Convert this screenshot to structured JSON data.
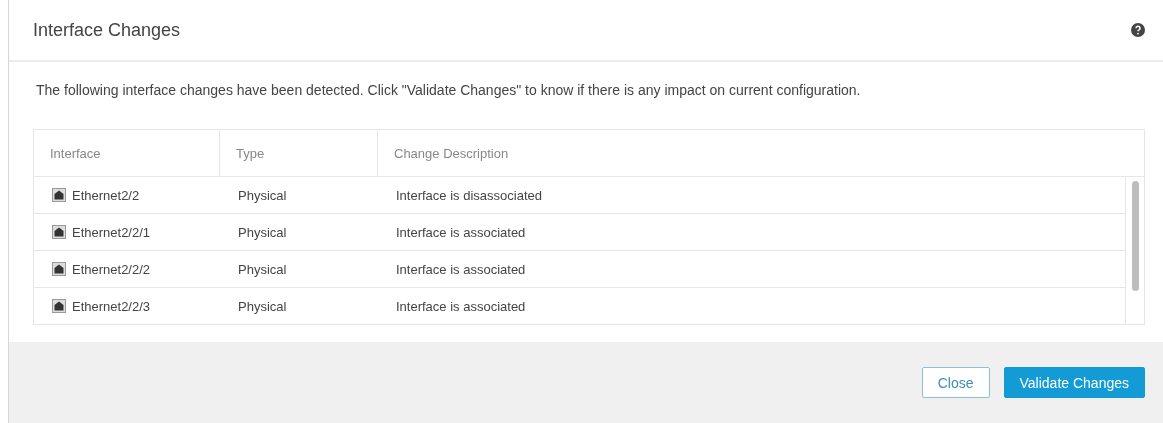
{
  "dialog": {
    "title": "Interface Changes",
    "description": "The following interface changes have been detected. Click \"Validate Changes\" to know if there is any impact on current configuration.",
    "table": {
      "columns": [
        "Interface",
        "Type",
        "Change Description"
      ],
      "rows": [
        {
          "interface": "Ethernet2/2",
          "type": "Physical",
          "change": "Interface is disassociated"
        },
        {
          "interface": "Ethernet2/2/1",
          "type": "Physical",
          "change": "Interface is associated"
        },
        {
          "interface": "Ethernet2/2/2",
          "type": "Physical",
          "change": "Interface is associated"
        },
        {
          "interface": "Ethernet2/2/3",
          "type": "Physical",
          "change": "Interface is associated"
        }
      ]
    },
    "buttons": [
      {
        "label": "Close",
        "kind": "secondary"
      },
      {
        "label": "Validate Changes",
        "kind": "primary"
      }
    ]
  }
}
